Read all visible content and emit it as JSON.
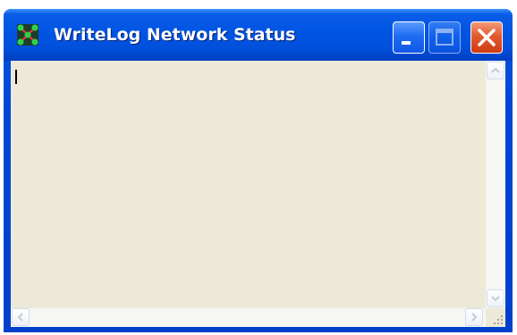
{
  "window": {
    "title": "WriteLog Network Status",
    "icon": "writelog-network-icon",
    "buttons": {
      "minimize": "minimize-icon",
      "maximize": "maximize-icon",
      "close": "close-icon"
    }
  },
  "content": {
    "text": ""
  },
  "colors": {
    "titlebar": "#0054e3",
    "client_bg": "#ece9d8",
    "close_button": "#e35a2e"
  }
}
